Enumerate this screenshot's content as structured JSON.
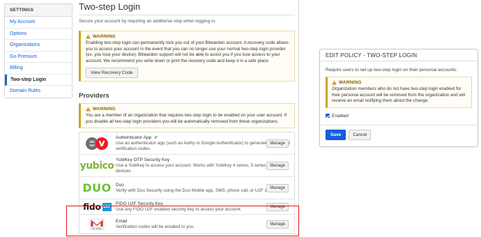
{
  "sidebar": {
    "header": "SETTINGS",
    "items": [
      {
        "label": "My Account"
      },
      {
        "label": "Options"
      },
      {
        "label": "Organizations"
      },
      {
        "label": "Go Premium"
      },
      {
        "label": "Billing"
      },
      {
        "label": "Two-step Login",
        "active": true
      },
      {
        "label": "Domain Rules"
      }
    ]
  },
  "main": {
    "title": "Two-step Login",
    "intro": "Secure your account by requiring an additional step when logging in.",
    "warning": {
      "title": "WARNING",
      "text": "Enabling two-step login can permanently lock you out of your Bitwarden account. A recovery code allows you to access your account in the event that you can no longer use your normal two-step login provider (ex. you lose your device). Bitwarden support will not be able to assist you if you lose access to your account. We recommend you write down or print the recovery code and keep it in a safe place.",
      "button": "View Recovery Code"
    },
    "providers_title": "Providers",
    "providers_warning": {
      "title": "WARNING",
      "text": "You are a member of an organization that requires two-step login to be enabled on your user account. If you disable all two-step login providers you will be automatically removed from these organizations."
    },
    "providers": [
      {
        "name": "Authenticator App",
        "desc": "Use an authenticator app (such as Authy or Google Authenticator) to generate time-based verification codes.",
        "manage": "Manage",
        "enabled": true
      },
      {
        "name": "YubiKey OTP Security Key",
        "desc": "Use a YubiKey to access your account. Works with YubiKey 4 series, 5 series, and NEO devices.",
        "manage": "Manage"
      },
      {
        "name": "Duo",
        "desc": "Verify with Duo Security using the Duo Mobile app, SMS, phone call, or U2F security key.",
        "manage": "Manage"
      },
      {
        "name": "FIDO U2F Security Key",
        "desc": "Use any FIDO U2F enabled security key to access your account.",
        "manage": "Manage"
      },
      {
        "name": "Email",
        "desc": "Verification codes will be emailed to you.",
        "manage": "Manage"
      }
    ],
    "logos": {
      "yubico": "yubico",
      "duo": "DUO",
      "fido": "fido",
      "fido_u2f": "U2F",
      "email_code": "01 2315"
    }
  },
  "modal": {
    "title": "EDIT POLICY - TWO-STEP LOGIN",
    "desc": "Require users to set up two-step login on their personal accounts.",
    "warning_title": "WARNING",
    "warning_text": "Organization members who do not have two-step login enabled for their personal account will be removed from the organization and will receive an email notifying them about the change.",
    "checkbox_label": "Enabled",
    "save": "Save",
    "cancel": "Cancel"
  },
  "colors": {
    "accent": "#175ddc",
    "warning": "#8a5b00",
    "highlight": "#e0141e"
  }
}
